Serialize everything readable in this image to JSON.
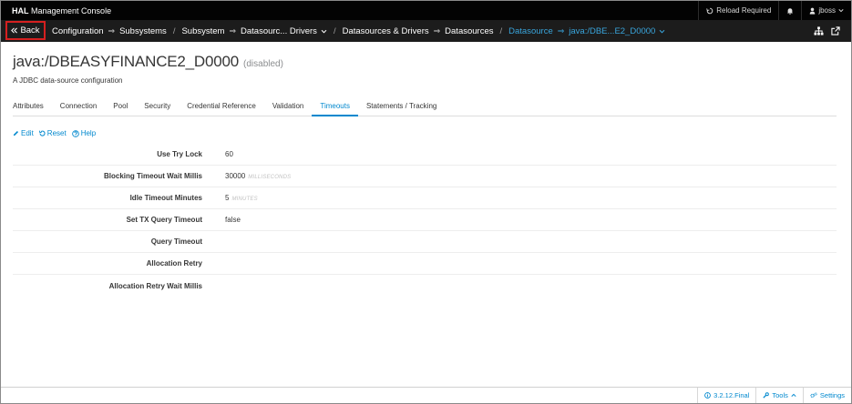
{
  "topbar": {
    "brand_bold": "HAL",
    "brand_rest": "Management Console",
    "reload_label": "Reload Required",
    "user_label": "jboss"
  },
  "navbar": {
    "back_label": "Back",
    "crumbs": [
      {
        "label": "Configuration"
      },
      {
        "label": "Subsystems"
      },
      {
        "label": "Subsystem"
      },
      {
        "label": "Datasourc... Drivers"
      },
      {
        "label": "Datasources & Drivers"
      },
      {
        "label": "Datasources"
      },
      {
        "label": "Datasource"
      },
      {
        "label": "java:/DBE...E2_D0000"
      }
    ]
  },
  "page": {
    "title": "java:/DBEASYFINANCE2_D0000",
    "status": "(disabled)",
    "description": "A JDBC data-source configuration"
  },
  "tabs": [
    {
      "label": "Attributes"
    },
    {
      "label": "Connection"
    },
    {
      "label": "Pool"
    },
    {
      "label": "Security"
    },
    {
      "label": "Credential Reference"
    },
    {
      "label": "Validation"
    },
    {
      "label": "Timeouts",
      "active": true
    },
    {
      "label": "Statements / Tracking"
    }
  ],
  "actions": {
    "edit_label": "Edit",
    "reset_label": "Reset",
    "help_label": "Help"
  },
  "attributes": [
    {
      "label": "Use Try Lock",
      "value": "60",
      "unit": ""
    },
    {
      "label": "Blocking Timeout Wait Millis",
      "value": "30000",
      "unit": "MILLISECONDS"
    },
    {
      "label": "Idle Timeout Minutes",
      "value": "5",
      "unit": "MINUTES"
    },
    {
      "label": "Set TX Query Timeout",
      "value": "false",
      "unit": ""
    },
    {
      "label": "Query Timeout",
      "value": "",
      "unit": ""
    },
    {
      "label": "Allocation Retry",
      "value": "",
      "unit": ""
    },
    {
      "label": "Allocation Retry Wait Millis",
      "value": "",
      "unit": ""
    }
  ],
  "footer": {
    "version_label": "3.2.12.Final",
    "tools_label": "Tools",
    "settings_label": "Settings"
  },
  "colors": {
    "accent": "#0088ce",
    "active_crumb": "#39a5dc",
    "highlight_box": "#d52020",
    "topbar_bg": "#030303",
    "navbar_bg": "#1c1c1c"
  },
  "icons": {
    "reload": "reload-icon",
    "bell": "bell-icon",
    "user": "user-icon",
    "back": "double-chevron-left-icon",
    "sitemap": "sitemap-icon",
    "external": "external-link-icon",
    "edit": "pencil-icon",
    "reset": "undo-icon",
    "help": "help-circle-icon",
    "info": "info-circle-icon",
    "tools": "wrench-icon",
    "settings": "cogs-icon"
  }
}
